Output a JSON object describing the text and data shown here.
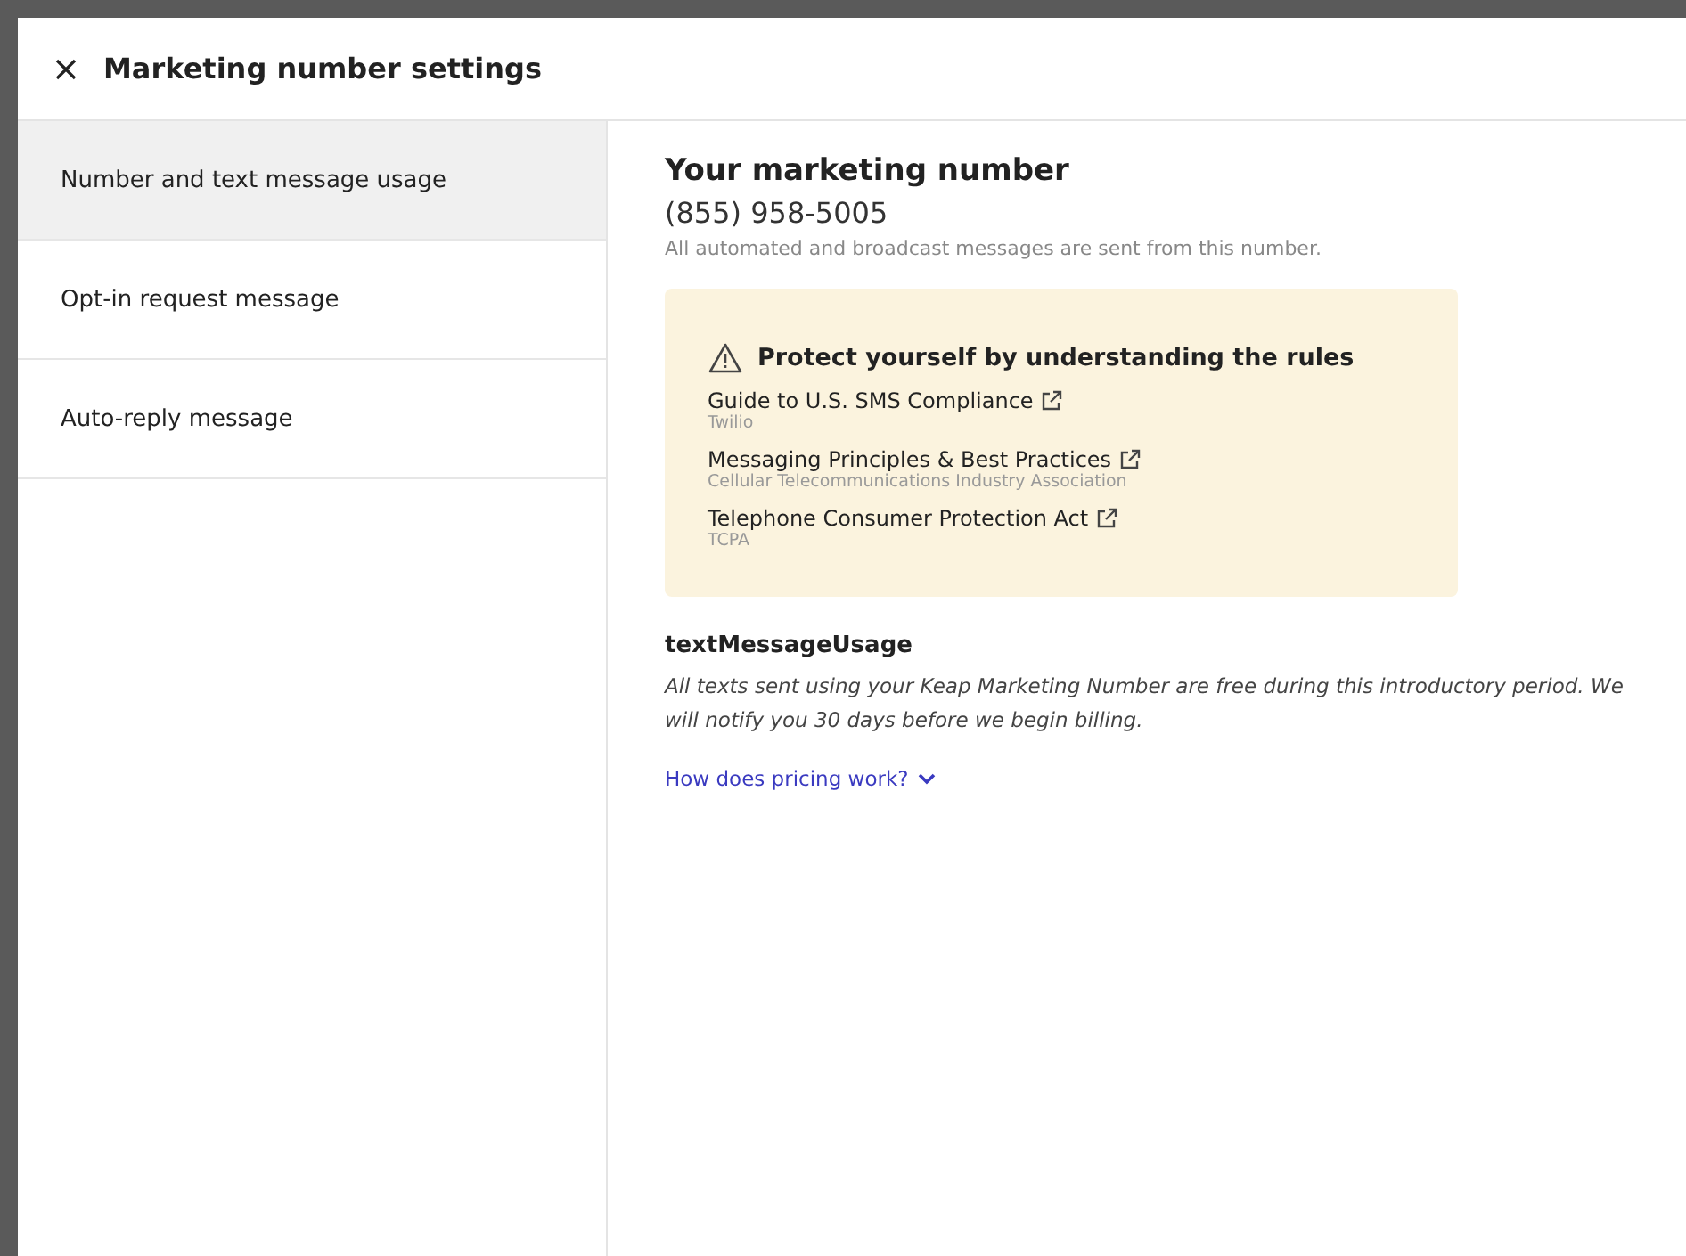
{
  "window": {
    "title": "Marketing number settings"
  },
  "sidebar": {
    "items": [
      {
        "label": "Number and text message usage",
        "selected": true
      },
      {
        "label": "Opt-in request message",
        "selected": false
      },
      {
        "label": "Auto-reply message",
        "selected": false
      }
    ]
  },
  "number": {
    "heading": "Your marketing number",
    "value": "(855) 958-5005",
    "note": "All automated and broadcast messages are sent from this number."
  },
  "notice": {
    "title": "Protect yourself by understanding the rules",
    "links": [
      {
        "label": "Guide to U.S. SMS Compliance",
        "source": "Twilio"
      },
      {
        "label": "Messaging Principles & Best Practices",
        "source": "Cellular Telecommunications Industry Association"
      },
      {
        "label": "Telephone Consumer Protection Act",
        "source": "TCPA"
      }
    ]
  },
  "usage": {
    "heading": "textMessageUsage",
    "text": "All texts sent using your Keap Marketing Number are free during this introductory period. We will notify you 30 days before we begin billing.",
    "link": "How does pricing work?",
    "expanded": false
  }
}
